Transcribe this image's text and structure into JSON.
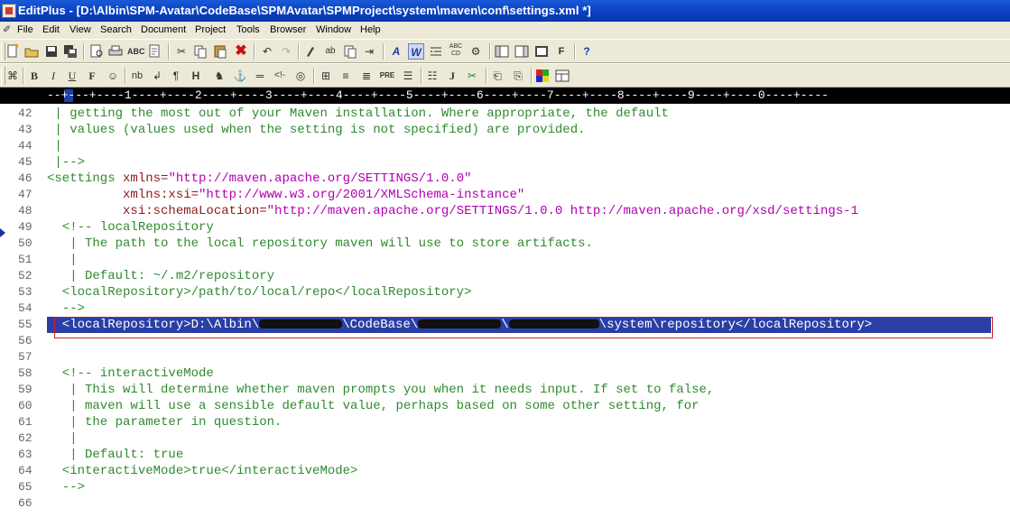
{
  "window": {
    "title": "EditPlus - [D:\\Albin\\SPM-Avatar\\CodeBase\\SPMAvatar\\SPMProject\\system\\maven\\conf\\settings.xml *]"
  },
  "menu": {
    "items": [
      "File",
      "Edit",
      "View",
      "Search",
      "Document",
      "Project",
      "Tools",
      "Browser",
      "Window",
      "Help"
    ]
  },
  "toolbar1": {
    "icons": [
      "new-file-icon",
      "open-icon",
      "save-icon",
      "save-all-icon",
      "print-preview-icon",
      "print-icon",
      "spell-check-icon",
      "page-icon",
      "cut-icon",
      "copy-icon",
      "paste-icon",
      "delete-icon",
      "undo-icon",
      "redo-icon",
      "find-icon",
      "replace-icon",
      "find-in-files-icon",
      "go-to-icon",
      "font-icon",
      "word-wrap-icon",
      "indent-icon",
      "column-select-icon",
      "settings-icon",
      "user-tools-icon",
      "directory-icon",
      "view-icon",
      "browser-icon",
      "help-icon"
    ]
  },
  "toolbar2": {
    "icons": [
      "html-toolbar-icon",
      "bold-icon",
      "italic-icon",
      "underline-icon",
      "font-tag-icon",
      "color-icon",
      "nbsp-icon",
      "break-icon",
      "paragraph-icon",
      "heading-icon",
      "image-icon",
      "anchor-icon",
      "hr-icon",
      "comment-icon",
      "center-icon",
      "table-icon",
      "align-left-icon",
      "align-center-icon",
      "pre-icon",
      "list-icon",
      "form-icon",
      "javascript-icon",
      "cliptext-icon",
      "page-icon",
      "preview-icon",
      "color-picker-icon",
      "frame-icon"
    ]
  },
  "ruler": {
    "text": "--+---+----1----+----2----+----3----+----4----+----5----+----6----+----7----+----8----+----9----+----0----+----"
  },
  "editor": {
    "lines": [
      {
        "num": "42",
        "text": " | getting the most out of your Maven installation. Where appropriate, the default"
      },
      {
        "num": "43",
        "text": " | values (values used when the setting is not specified) are provided."
      },
      {
        "num": "44",
        "text": " |"
      },
      {
        "num": "45",
        "text": " |-->"
      },
      {
        "num": "46",
        "tag": "<settings",
        "attr": " xmlns=",
        "val": "\"http://maven.apache.org/SETTINGS/1.0.0\""
      },
      {
        "num": "47",
        "indent": "          ",
        "attr": "xmlns:xsi=",
        "val": "\"http://www.w3.org/2001/XMLSchema-instance\""
      },
      {
        "num": "48",
        "indent": "          ",
        "attr": "xsi:schemaLocation=",
        "val": "\"http://maven.apache.org/SETTINGS/1.0.0 http://maven.apache.org/xsd/settings-1"
      },
      {
        "num": "49",
        "text": "  <!-- localRepository"
      },
      {
        "num": "50",
        "text": "   | The path to the local repository maven will use to store artifacts."
      },
      {
        "num": "51",
        "text": "   |"
      },
      {
        "num": "52",
        "text": "   | Default: ~/.m2/repository"
      },
      {
        "num": "53",
        "text": "  <localRepository>/path/to/local/repo</localRepository>"
      },
      {
        "num": "54",
        "text": "  -->"
      },
      {
        "num": "55",
        "selected": true,
        "part1": "  <localRepository>D:\\Albin\\",
        "part2": "\\CodeBase\\",
        "part3": "\\",
        "part4": "\\system\\repository</localRepository>"
      },
      {
        "num": "56",
        "text": ""
      },
      {
        "num": "57",
        "text": ""
      },
      {
        "num": "58",
        "text": "  <!-- interactiveMode"
      },
      {
        "num": "59",
        "text": "   | This will determine whether maven prompts you when it needs input. If set to false,"
      },
      {
        "num": "60",
        "text": "   | maven will use a sensible default value, perhaps based on some other setting, for"
      },
      {
        "num": "61",
        "text": "   | the parameter in question."
      },
      {
        "num": "62",
        "text": "   |"
      },
      {
        "num": "63",
        "text": "   | Default: true"
      },
      {
        "num": "64",
        "text": "  <interactiveMode>true</interactiveMode>"
      },
      {
        "num": "65",
        "text": "  -->"
      },
      {
        "num": "66",
        "text": ""
      }
    ]
  },
  "colors": {
    "comment": "#2e8b2e",
    "attribute": "#8b1a1a",
    "value": "#b000b0",
    "selection": "#2a3fa6",
    "highlight_box": "#cc2222"
  }
}
